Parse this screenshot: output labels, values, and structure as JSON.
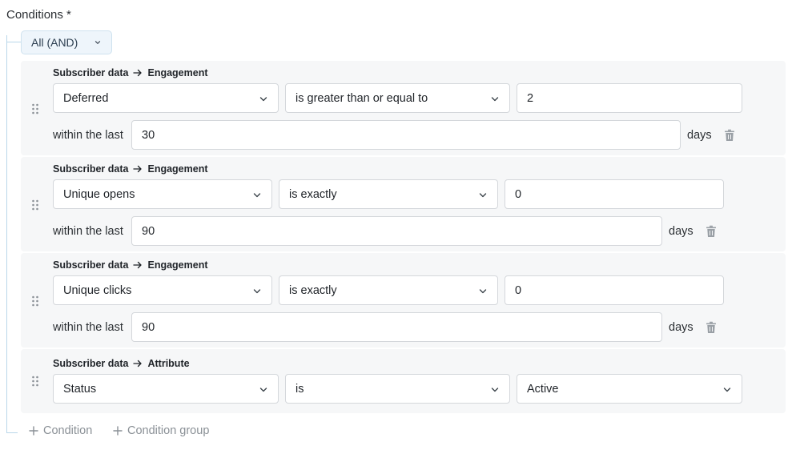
{
  "header": {
    "label": "Conditions *"
  },
  "group": {
    "operator_label": "All (AND)"
  },
  "conditions": [
    {
      "crumb_source": "Subscriber data",
      "crumb_target": "Engagement",
      "field": "Deferred",
      "operator": "is greater than or equal to",
      "value": "2",
      "within_label": "within the last",
      "within_value": "30",
      "unit": "days"
    },
    {
      "crumb_source": "Subscriber data",
      "crumb_target": "Engagement",
      "field": "Unique opens",
      "operator": "is exactly",
      "value": "0",
      "within_label": "within the last",
      "within_value": "90",
      "unit": "days"
    },
    {
      "crumb_source": "Subscriber data",
      "crumb_target": "Engagement",
      "field": "Unique clicks",
      "operator": "is exactly",
      "value": "0",
      "within_label": "within the last",
      "within_value": "90",
      "unit": "days"
    },
    {
      "crumb_source": "Subscriber data",
      "crumb_target": "Attribute",
      "field": "Status",
      "operator": "is",
      "value": "Active"
    }
  ],
  "actions": {
    "add_condition": "Condition",
    "add_group": "Condition group"
  }
}
